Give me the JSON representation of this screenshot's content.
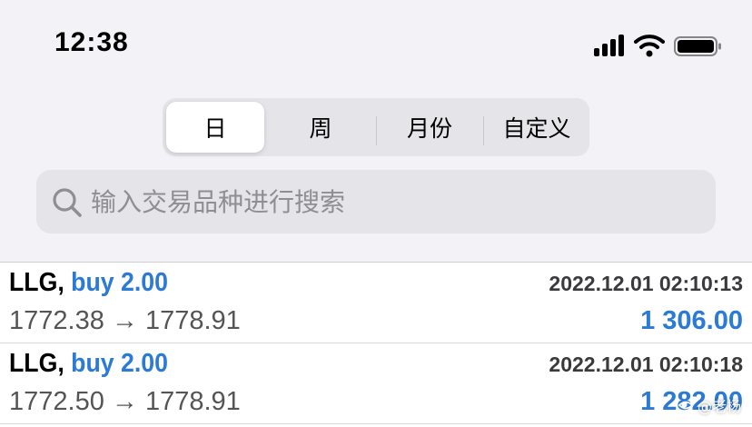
{
  "status_bar": {
    "time": "12:38",
    "icons": [
      "signal-icon",
      "wifi-icon",
      "battery-icon"
    ]
  },
  "period_tabs": {
    "items": [
      "日",
      "周",
      "月份",
      "自定义"
    ],
    "selected": "日"
  },
  "search": {
    "placeholder": "输入交易品种进行搜索",
    "value": ""
  },
  "trades": [
    {
      "symbol": "LLG,",
      "side": "buy 2.00",
      "time": "2022.12.01 02:10:13",
      "open_price": "1772.38",
      "arrow": "→",
      "close_price": "1778.91",
      "profit": "1 306.00"
    },
    {
      "symbol": "LLG,",
      "side": "buy 2.00",
      "time": "2022.12.01 02:10:18",
      "open_price": "1772.50",
      "arrow": "→",
      "close_price": "1778.91",
      "profit": "1 282.00"
    }
  ],
  "watermark": {
    "text": "@老杨"
  },
  "colors": {
    "background": "#f2f2f7",
    "accent_blue": "#2a7ad6",
    "control_fill": "#e4e4e9",
    "placeholder": "#8e8e93"
  }
}
